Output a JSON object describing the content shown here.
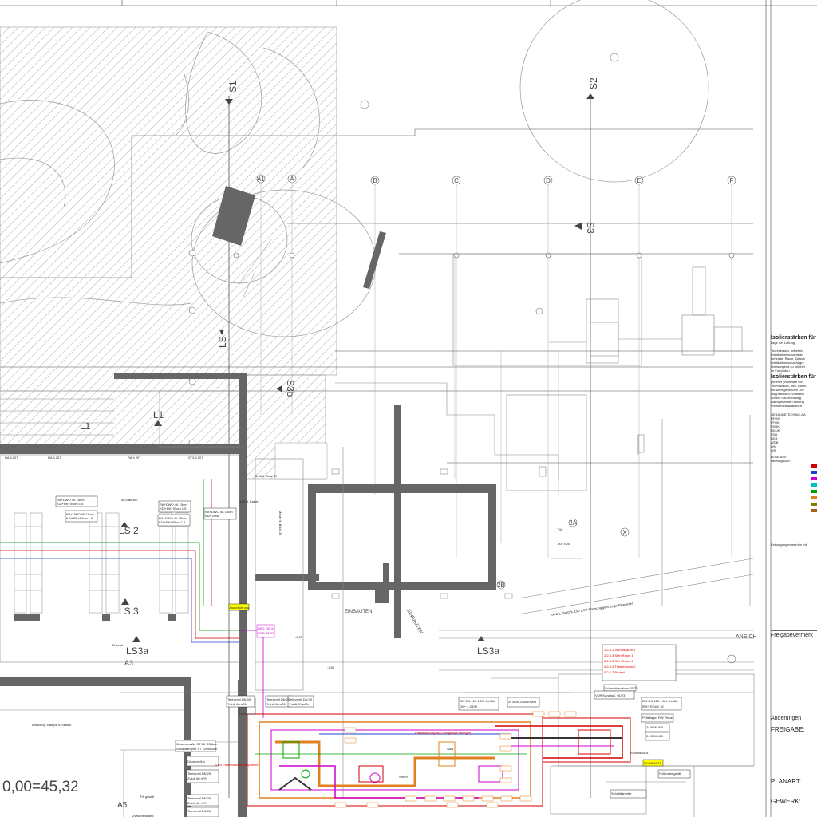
{
  "sections": {
    "s1": "S1",
    "s2": "S2",
    "s3": "S3",
    "s3b": "S3b",
    "ls": "LS",
    "ls2": "LS 2",
    "ls3": "LS 3",
    "ls3a": "LS3a",
    "ls3a_lower": "LS3a",
    "l1": "L1",
    "l1_arrow": "L1",
    "a1": "A1",
    "a5": "A5",
    "a3": "A3"
  },
  "axes": [
    "A1",
    "A",
    "B",
    "C",
    "D",
    "E",
    "F"
  ],
  "grid_circles": [
    "2A",
    "2B",
    "X"
  ],
  "labels": {
    "einbauten": "EINBAUTEN",
    "ansicht": "ANSICH",
    "einbauten2": "EINBAUTEN"
  },
  "elevation": "0,00=45,32",
  "legend": {
    "title1": "Isolierstärken für",
    "title2": "Isolierstärken für",
    "lage": "Lage der Leitung",
    "rows": [
      "Technikraum, unbeheiz",
      "Installationsschacht an",
      "beheizter Raum, Zwisch",
      "Installationsschacht gre",
      "übersangend zu beheizt",
      "im Fußboden",
      "generell (innerhalb von",
      "Technikraum, beh. Raum",
      "mit warmgehenden Leit",
      "Doppelboden, Vorwand",
      "unbeh. Raum/ beweg",
      "warmgehenden Leitung",
      "Vorwandinstallationen"
    ],
    "gebaeude": "GEBÄUDETECHNIK-BA",
    "abbr": [
      "RFGK",
      "FFGK",
      "FDUK",
      "RDUK",
      "FDB",
      "DDB",
      "WDB",
      "WN",
      "WS"
    ],
    "legende": "LEGENDE:",
    "heizung": "Heizungflüße:",
    "entsorgung": "Entsorgungen werden mit"
  },
  "stamps": {
    "freigabe_head": "Freigabevermerk",
    "aenderungen": "Änderungen",
    "freigabe": "FREIGABE:",
    "planart": "PLANART:",
    "gewerk": "GEWERK:"
  },
  "colors": {
    "red": "#d00000",
    "magenta": "#cc00cc",
    "orange": "#e08020",
    "green": "#00a000",
    "blue": "#2040d0",
    "wall": "#666666",
    "line": "#888888"
  }
}
